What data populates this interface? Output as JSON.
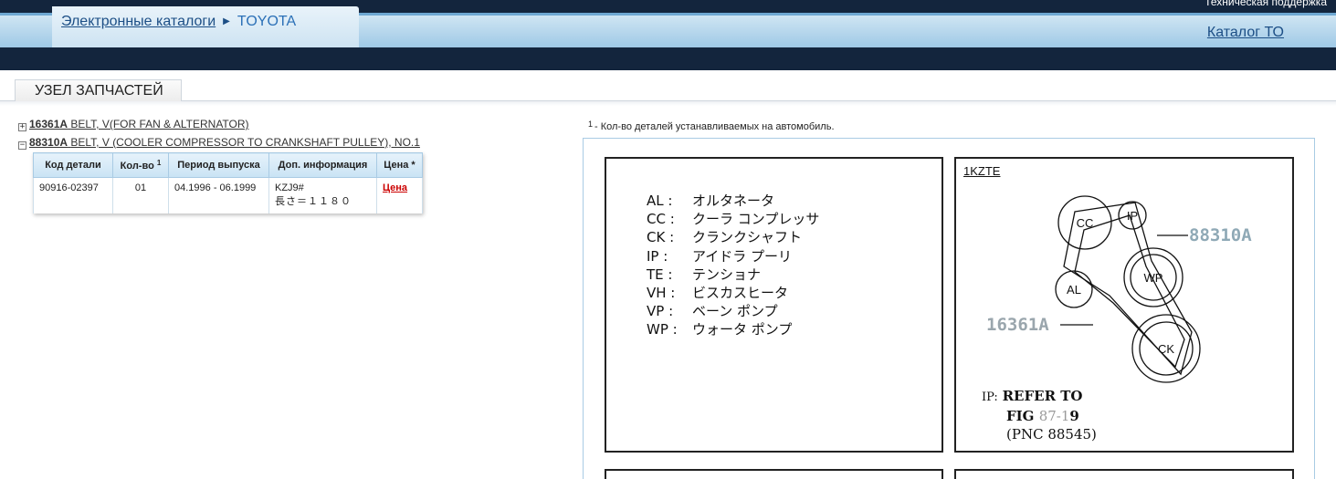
{
  "header": {
    "support_label": "Техническая поддержка",
    "breadcrumb_link": "Электронные каталоги",
    "breadcrumb_current": "TOYOTA",
    "catalog_to_label": "Каталог ТО"
  },
  "tab": {
    "label": "УЗЕЛ ЗАПЧАСТЕЙ"
  },
  "tree": [
    {
      "toggle": "+",
      "code": "16361A",
      "name": "BELT, V(FOR FAN & ALTERNATOR)"
    },
    {
      "toggle": "−",
      "code": "88310A",
      "name": "BELT, V (COOLER COMPRESSOR TO CRANKSHAFT PULLEY), NO.1"
    }
  ],
  "table": {
    "headers": [
      "Код детали",
      "Кол-во",
      "Период выпуска",
      "Доп. информация",
      "Цена *"
    ],
    "qty_sup": "1",
    "row": {
      "code": "90916-02397",
      "qty": "01",
      "period": "04.1996 - 06.1999",
      "info_line1": "KZJ9#",
      "info_line2": "長さ＝１１８０",
      "price_label": "Цена"
    }
  },
  "footnote": {
    "num": "1",
    "text": "- Кол-во деталей устанавливаемых на автомобиль."
  },
  "diagram": {
    "legend": [
      {
        "key": "AL :",
        "value": "オルタネータ"
      },
      {
        "key": "CC :",
        "value": "クーラ コンプレッサ"
      },
      {
        "key": "CK :",
        "value": "クランクシャフト"
      },
      {
        "key": "IP :",
        "value": "アイドラ プーリ"
      },
      {
        "key": "TE :",
        "value": "テンショナ"
      },
      {
        "key": "VH :",
        "value": "ビスカスヒータ"
      },
      {
        "key": "VP :",
        "value": "ベーン ポンプ"
      },
      {
        "key": "WP :",
        "value": "ウォータ ポンプ"
      }
    ],
    "engine": "1KZTE",
    "pulleys": {
      "cc": "CC",
      "ip": "IP",
      "wp": "WP",
      "al": "AL",
      "ck": "CK"
    },
    "part_a": "88310A",
    "part_b": "16361A",
    "refer": {
      "prefix": "IP:",
      "line1": "REFER TO",
      "line2_a": "FIG ",
      "line2_b": "87-1",
      "line2_c": "9",
      "line3": "(PNC 88545)"
    }
  }
}
